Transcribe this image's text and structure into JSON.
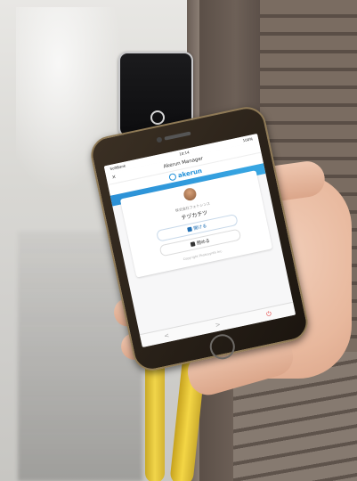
{
  "scene": {
    "description": "Hand holding a smartphone with Akerun Manager app near a wall-mounted Akerun smart lock device"
  },
  "phone_screen": {
    "carrier": "SoftBank",
    "time": "10:14",
    "battery": "100%",
    "nav_title": "Akerun Manager",
    "nav_close": "×",
    "brand": "akerun",
    "group_name": "株式会社フォトシンス",
    "user_name": "テヅカテツ",
    "open_button": "開ける",
    "close_button": "閉める",
    "footer_note": "Copyright Photosynth Inc.",
    "toolbar": {
      "back": "<",
      "forward": ">",
      "power": "⏻"
    }
  },
  "colors": {
    "brand_blue": "#1f8fd8",
    "cable_yellow": "#f1d54a",
    "power_red": "#e23b3b"
  }
}
